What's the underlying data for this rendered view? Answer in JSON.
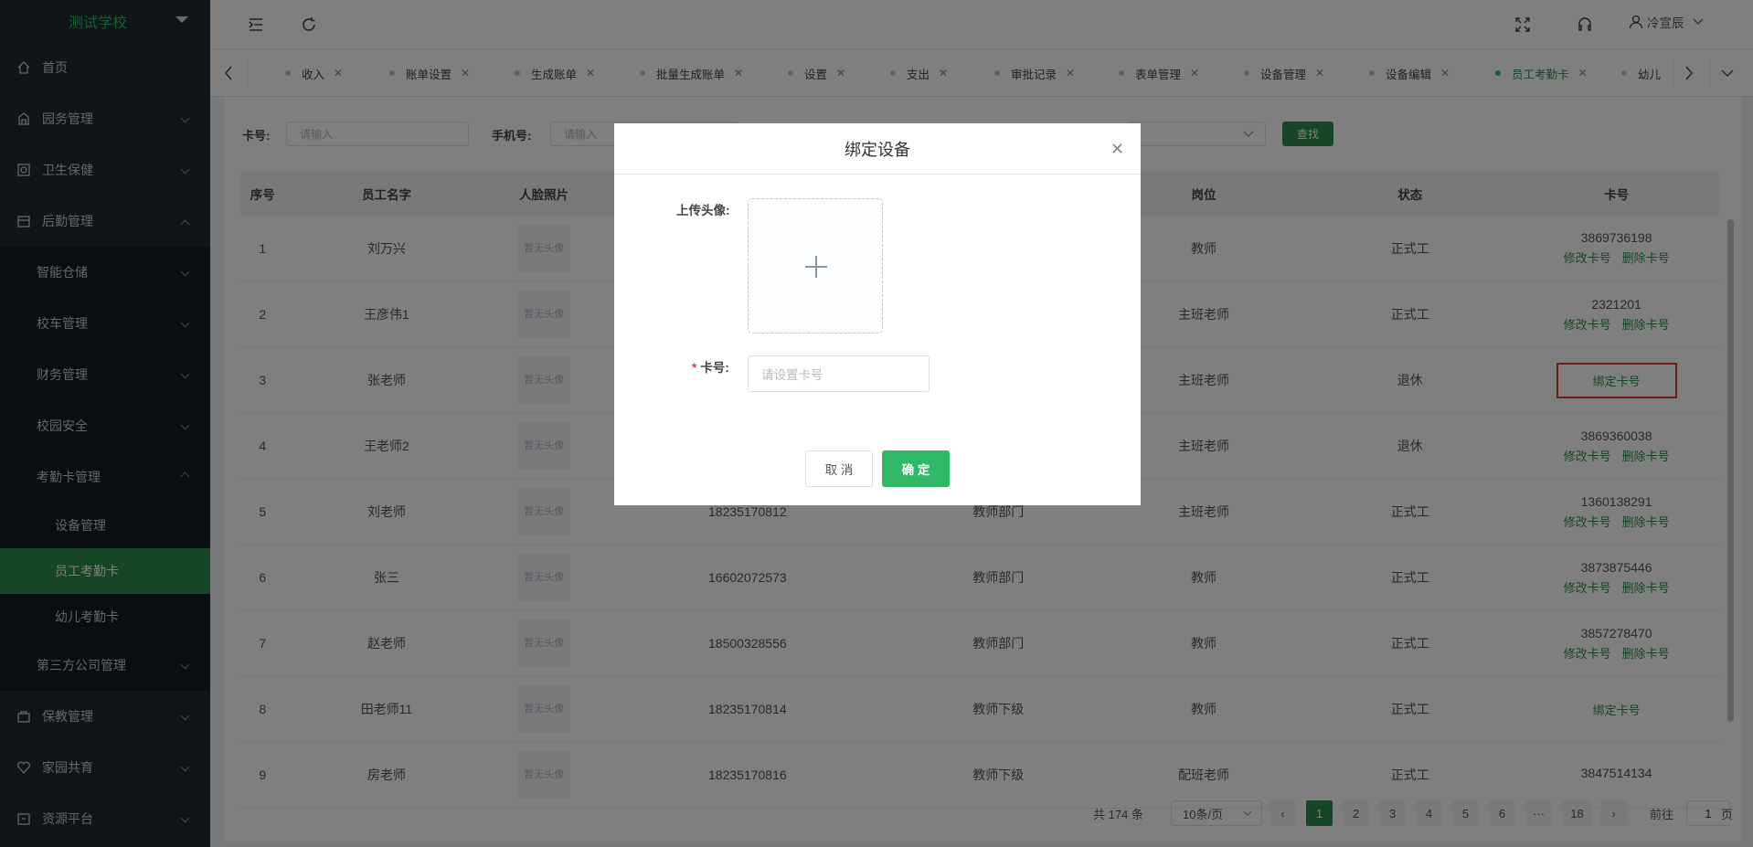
{
  "sidebar": {
    "brand": "测试学校",
    "items": [
      {
        "label": "首页"
      },
      {
        "label": "园务管理"
      },
      {
        "label": "卫生保健"
      },
      {
        "label": "后勤管理"
      },
      {
        "label": "智能仓储"
      },
      {
        "label": "校车管理"
      },
      {
        "label": "财务管理"
      },
      {
        "label": "校园安全"
      },
      {
        "label": "考勤卡管理"
      },
      {
        "label": "设备管理"
      },
      {
        "label": "员工考勤卡"
      },
      {
        "label": "幼儿考勤卡"
      },
      {
        "label": "第三方公司管理"
      },
      {
        "label": "保教管理"
      },
      {
        "label": "家园共育"
      },
      {
        "label": "资源平台"
      }
    ]
  },
  "header": {
    "user": "冷宣辰"
  },
  "tabs": [
    "收入",
    "账单设置",
    "生成账单",
    "批量生成账单",
    "设置",
    "支出",
    "审批记录",
    "表单管理",
    "设备管理",
    "设备编辑",
    "员工考勤卡",
    "幼儿"
  ],
  "filters": {
    "card_label": "卡号:",
    "card_placeholder": "请输入",
    "phone_label": "手机号:",
    "phone_placeholder": "请输入",
    "search_label": "查找"
  },
  "table": {
    "headers": [
      "序号",
      "员工名字",
      "人脸照片",
      "",
      "",
      "岗位",
      "状态",
      "卡号"
    ],
    "avatar_text": "暂无头像",
    "edit_label": "修改卡号",
    "delete_label": "删除卡号",
    "bind_label": "绑定卡号",
    "rows": [
      {
        "no": "1",
        "name": "刘万兴",
        "phone": "",
        "dept": "",
        "post": "教师",
        "status": "正式工",
        "card": "3869736198"
      },
      {
        "no": "2",
        "name": "王彦伟1",
        "phone": "",
        "dept": "",
        "post": "主班老师",
        "status": "正式工",
        "card": "2321201"
      },
      {
        "no": "3",
        "name": "张老师",
        "phone": "",
        "dept": "",
        "post": "主班老师",
        "status": "退休",
        "card": ""
      },
      {
        "no": "4",
        "name": "王老师2",
        "phone": "",
        "dept": "",
        "post": "主班老师",
        "status": "退休",
        "card": "3869360038"
      },
      {
        "no": "5",
        "name": "刘老师",
        "phone": "18235170812",
        "dept": "教师部门",
        "post": "主班老师",
        "status": "正式工",
        "card": "1360138291"
      },
      {
        "no": "6",
        "name": "张三",
        "phone": "16602072573",
        "dept": "教师部门",
        "post": "教师",
        "status": "正式工",
        "card": "3873875446"
      },
      {
        "no": "7",
        "name": "赵老师",
        "phone": "18500328556",
        "dept": "教师部门",
        "post": "教师",
        "status": "正式工",
        "card": "3857278470"
      },
      {
        "no": "8",
        "name": "田老师11",
        "phone": "18235170814",
        "dept": "教师下级",
        "post": "教师",
        "status": "正式工",
        "card": ""
      },
      {
        "no": "9",
        "name": "房老师",
        "phone": "18235170816",
        "dept": "教师下级",
        "post": "配班老师",
        "status": "正式工",
        "card": "3847514134"
      }
    ]
  },
  "pagination": {
    "total": "共 174 条",
    "page_size": "10条/页",
    "pages": [
      "1",
      "2",
      "3",
      "4",
      "5",
      "6",
      "···",
      "18"
    ],
    "current": "1",
    "goto_prefix": "前往",
    "goto_value": "1",
    "goto_suffix": "页"
  },
  "modal": {
    "title": "绑定设备",
    "upload_label": "上传头像:",
    "card_label": "卡号:",
    "card_placeholder": "请设置卡号",
    "cancel_label": "取 消",
    "ok_label": "确 定"
  },
  "colors": {
    "accent": "#2e8b4e",
    "brand": "#2fb866",
    "highlight": "#e53935",
    "sidebar_bg": "#1f2a33"
  }
}
